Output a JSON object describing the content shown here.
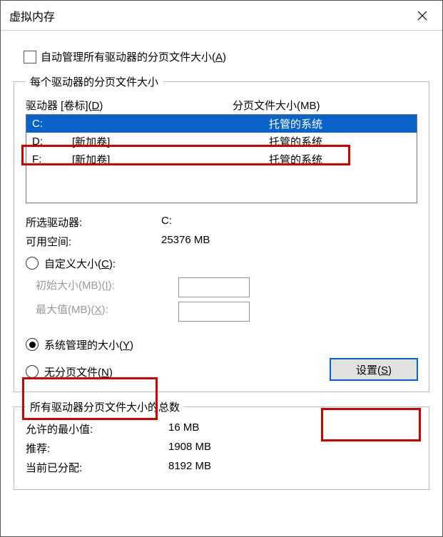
{
  "title": "虚拟内存",
  "auto_manage_label": "自动管理所有驱动器的分页文件大小(A)",
  "section1_legend": "每个驱动器的分页文件大小",
  "drive_header": "驱动器 [卷标](D)",
  "paging_header": "分页文件大小(MB)",
  "drives": [
    {
      "letter": "C:",
      "label": "",
      "paging": "托管的系统",
      "selected": true
    },
    {
      "letter": "D:",
      "label": "[新加卷]",
      "paging": "托管的系统",
      "selected": false
    },
    {
      "letter": "F:",
      "label": "[新加卷]",
      "paging": "托管的系统",
      "selected": false
    }
  ],
  "selected_drive_label": "所选驱动器:",
  "selected_drive_value": "C:",
  "avail_space_label": "可用空间:",
  "avail_space_value": "25376 MB",
  "custom_size_label": "自定义大小(C):",
  "initial_size_label": "初始大小(MB)(I):",
  "max_size_label": "最大值(MB)(X):",
  "system_managed_label": "系统管理的大小(Y)",
  "no_paging_label": "无分页文件(N)",
  "set_button_label": "设置(S)",
  "section2_legend": "所有驱动器分页文件大小的总数",
  "min_allowed_label": "允许的最小值:",
  "min_allowed_value": "16 MB",
  "recommended_label": "推荐:",
  "recommended_value": "1908 MB",
  "allocated_label": "当前已分配:",
  "allocated_value": "8192 MB"
}
